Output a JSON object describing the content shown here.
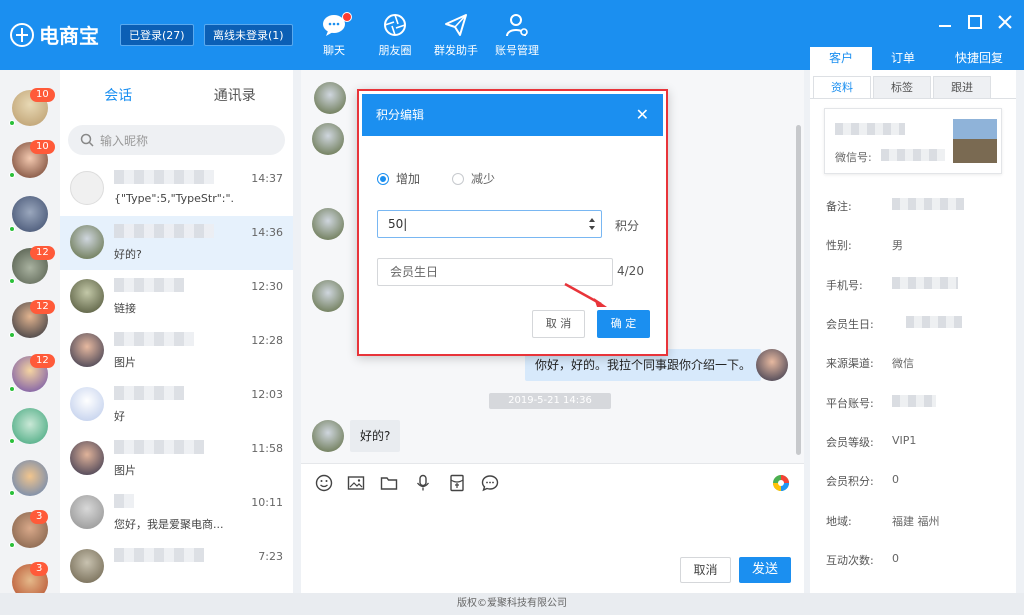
{
  "app": {
    "logo_text": "电商宝",
    "logged_in": "已登录(27)",
    "offline": "离线未登录(1)"
  },
  "nav": [
    {
      "label": "聊天",
      "icon": "chat-bubble-icon"
    },
    {
      "label": "朋友圈",
      "icon": "camera-aperture-icon"
    },
    {
      "label": "群发助手",
      "icon": "paper-plane-icon"
    },
    {
      "label": "账号管理",
      "icon": "user-gear-icon"
    }
  ],
  "right_tabs": [
    "客户",
    "订单",
    "快捷回复"
  ],
  "conv_tabs": [
    "会话",
    "通讯录"
  ],
  "search": {
    "placeholder": "输入昵称"
  },
  "avatar_counts": [
    "10",
    "10",
    "12",
    "12",
    "12",
    "3",
    "3"
  ],
  "conversations": [
    {
      "msg": "{\"Type\":5,\"TypeStr\":\"...",
      "time": "14:37"
    },
    {
      "msg": "好的?",
      "time": "14:36"
    },
    {
      "msg": "链接",
      "time": "12:30"
    },
    {
      "msg": "图片",
      "time": "12:28"
    },
    {
      "msg": "好",
      "time": "12:03"
    },
    {
      "msg": "图片",
      "time": "11:58"
    },
    {
      "msg": "您好，我是爱聚电商...",
      "time": "10:11"
    },
    {
      "msg": "",
      "time": "7:23"
    }
  ],
  "chat": {
    "bubble_right": "你好，好的。我拉个同事跟你介绍一下。",
    "timestamp": "2019-5-21 14:36",
    "bubble_left": "好的?",
    "cancel": "取消",
    "send": "发送"
  },
  "dialog": {
    "title": "积分编辑",
    "close": "✕",
    "opt_add": "增加",
    "opt_sub": "减少",
    "points_value": "50",
    "unit": "积分",
    "note_placeholder": "会员生日",
    "char_count": "4/20",
    "cancel": "取 消",
    "confirm": "确 定"
  },
  "profile": {
    "subtabs": [
      "资料",
      "标签",
      "跟进"
    ],
    "wechat_label": "微信号:",
    "rows": [
      {
        "label": "备注:",
        "value": ""
      },
      {
        "label": "性别:",
        "value": "男"
      },
      {
        "label": "手机号:",
        "value": ""
      },
      {
        "label": "会员生日:",
        "value": ""
      },
      {
        "label": "来源渠道:",
        "value": "微信"
      },
      {
        "label": "平台账号:",
        "value": ""
      },
      {
        "label": "会员等级:",
        "value": "VIP1"
      },
      {
        "label": "会员积分:",
        "value": "0"
      },
      {
        "label": "地域:",
        "value": "福建 福州"
      },
      {
        "label": "互动次数:",
        "value": "0"
      }
    ]
  },
  "footer": "版权©爱聚科技有限公司",
  "colors": {
    "brand": "#1b8ff0",
    "badge": "#ff5a39",
    "online": "#2bc03a",
    "highlight": "#e8343a"
  }
}
